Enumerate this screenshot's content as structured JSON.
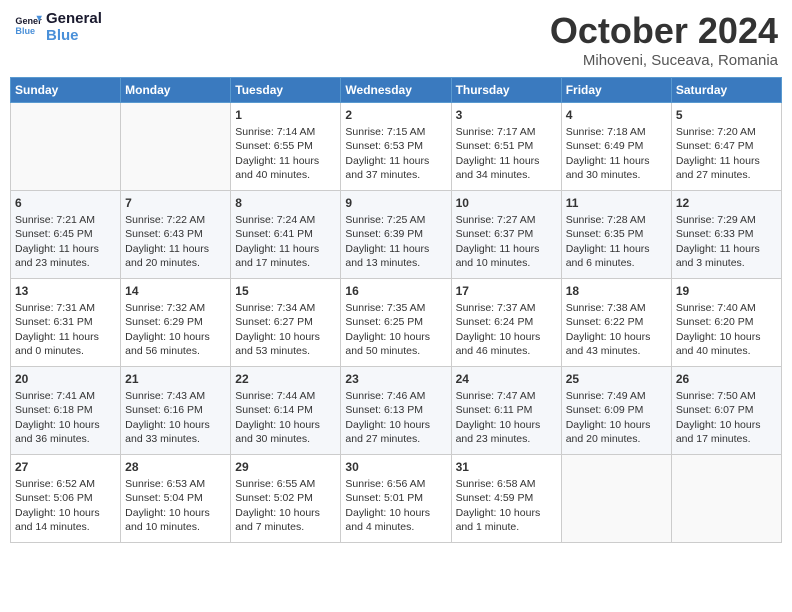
{
  "header": {
    "logo_line1": "General",
    "logo_line2": "Blue",
    "month": "October 2024",
    "location": "Mihoveni, Suceava, Romania"
  },
  "weekdays": [
    "Sunday",
    "Monday",
    "Tuesday",
    "Wednesday",
    "Thursday",
    "Friday",
    "Saturday"
  ],
  "rows": [
    [
      {
        "day": "",
        "info": ""
      },
      {
        "day": "",
        "info": ""
      },
      {
        "day": "1",
        "info": "Sunrise: 7:14 AM\nSunset: 6:55 PM\nDaylight: 11 hours and 40 minutes."
      },
      {
        "day": "2",
        "info": "Sunrise: 7:15 AM\nSunset: 6:53 PM\nDaylight: 11 hours and 37 minutes."
      },
      {
        "day": "3",
        "info": "Sunrise: 7:17 AM\nSunset: 6:51 PM\nDaylight: 11 hours and 34 minutes."
      },
      {
        "day": "4",
        "info": "Sunrise: 7:18 AM\nSunset: 6:49 PM\nDaylight: 11 hours and 30 minutes."
      },
      {
        "day": "5",
        "info": "Sunrise: 7:20 AM\nSunset: 6:47 PM\nDaylight: 11 hours and 27 minutes."
      }
    ],
    [
      {
        "day": "6",
        "info": "Sunrise: 7:21 AM\nSunset: 6:45 PM\nDaylight: 11 hours and 23 minutes."
      },
      {
        "day": "7",
        "info": "Sunrise: 7:22 AM\nSunset: 6:43 PM\nDaylight: 11 hours and 20 minutes."
      },
      {
        "day": "8",
        "info": "Sunrise: 7:24 AM\nSunset: 6:41 PM\nDaylight: 11 hours and 17 minutes."
      },
      {
        "day": "9",
        "info": "Sunrise: 7:25 AM\nSunset: 6:39 PM\nDaylight: 11 hours and 13 minutes."
      },
      {
        "day": "10",
        "info": "Sunrise: 7:27 AM\nSunset: 6:37 PM\nDaylight: 11 hours and 10 minutes."
      },
      {
        "day": "11",
        "info": "Sunrise: 7:28 AM\nSunset: 6:35 PM\nDaylight: 11 hours and 6 minutes."
      },
      {
        "day": "12",
        "info": "Sunrise: 7:29 AM\nSunset: 6:33 PM\nDaylight: 11 hours and 3 minutes."
      }
    ],
    [
      {
        "day": "13",
        "info": "Sunrise: 7:31 AM\nSunset: 6:31 PM\nDaylight: 11 hours and 0 minutes."
      },
      {
        "day": "14",
        "info": "Sunrise: 7:32 AM\nSunset: 6:29 PM\nDaylight: 10 hours and 56 minutes."
      },
      {
        "day": "15",
        "info": "Sunrise: 7:34 AM\nSunset: 6:27 PM\nDaylight: 10 hours and 53 minutes."
      },
      {
        "day": "16",
        "info": "Sunrise: 7:35 AM\nSunset: 6:25 PM\nDaylight: 10 hours and 50 minutes."
      },
      {
        "day": "17",
        "info": "Sunrise: 7:37 AM\nSunset: 6:24 PM\nDaylight: 10 hours and 46 minutes."
      },
      {
        "day": "18",
        "info": "Sunrise: 7:38 AM\nSunset: 6:22 PM\nDaylight: 10 hours and 43 minutes."
      },
      {
        "day": "19",
        "info": "Sunrise: 7:40 AM\nSunset: 6:20 PM\nDaylight: 10 hours and 40 minutes."
      }
    ],
    [
      {
        "day": "20",
        "info": "Sunrise: 7:41 AM\nSunset: 6:18 PM\nDaylight: 10 hours and 36 minutes."
      },
      {
        "day": "21",
        "info": "Sunrise: 7:43 AM\nSunset: 6:16 PM\nDaylight: 10 hours and 33 minutes."
      },
      {
        "day": "22",
        "info": "Sunrise: 7:44 AM\nSunset: 6:14 PM\nDaylight: 10 hours and 30 minutes."
      },
      {
        "day": "23",
        "info": "Sunrise: 7:46 AM\nSunset: 6:13 PM\nDaylight: 10 hours and 27 minutes."
      },
      {
        "day": "24",
        "info": "Sunrise: 7:47 AM\nSunset: 6:11 PM\nDaylight: 10 hours and 23 minutes."
      },
      {
        "day": "25",
        "info": "Sunrise: 7:49 AM\nSunset: 6:09 PM\nDaylight: 10 hours and 20 minutes."
      },
      {
        "day": "26",
        "info": "Sunrise: 7:50 AM\nSunset: 6:07 PM\nDaylight: 10 hours and 17 minutes."
      }
    ],
    [
      {
        "day": "27",
        "info": "Sunrise: 6:52 AM\nSunset: 5:06 PM\nDaylight: 10 hours and 14 minutes."
      },
      {
        "day": "28",
        "info": "Sunrise: 6:53 AM\nSunset: 5:04 PM\nDaylight: 10 hours and 10 minutes."
      },
      {
        "day": "29",
        "info": "Sunrise: 6:55 AM\nSunset: 5:02 PM\nDaylight: 10 hours and 7 minutes."
      },
      {
        "day": "30",
        "info": "Sunrise: 6:56 AM\nSunset: 5:01 PM\nDaylight: 10 hours and 4 minutes."
      },
      {
        "day": "31",
        "info": "Sunrise: 6:58 AM\nSunset: 4:59 PM\nDaylight: 10 hours and 1 minute."
      },
      {
        "day": "",
        "info": ""
      },
      {
        "day": "",
        "info": ""
      }
    ]
  ]
}
